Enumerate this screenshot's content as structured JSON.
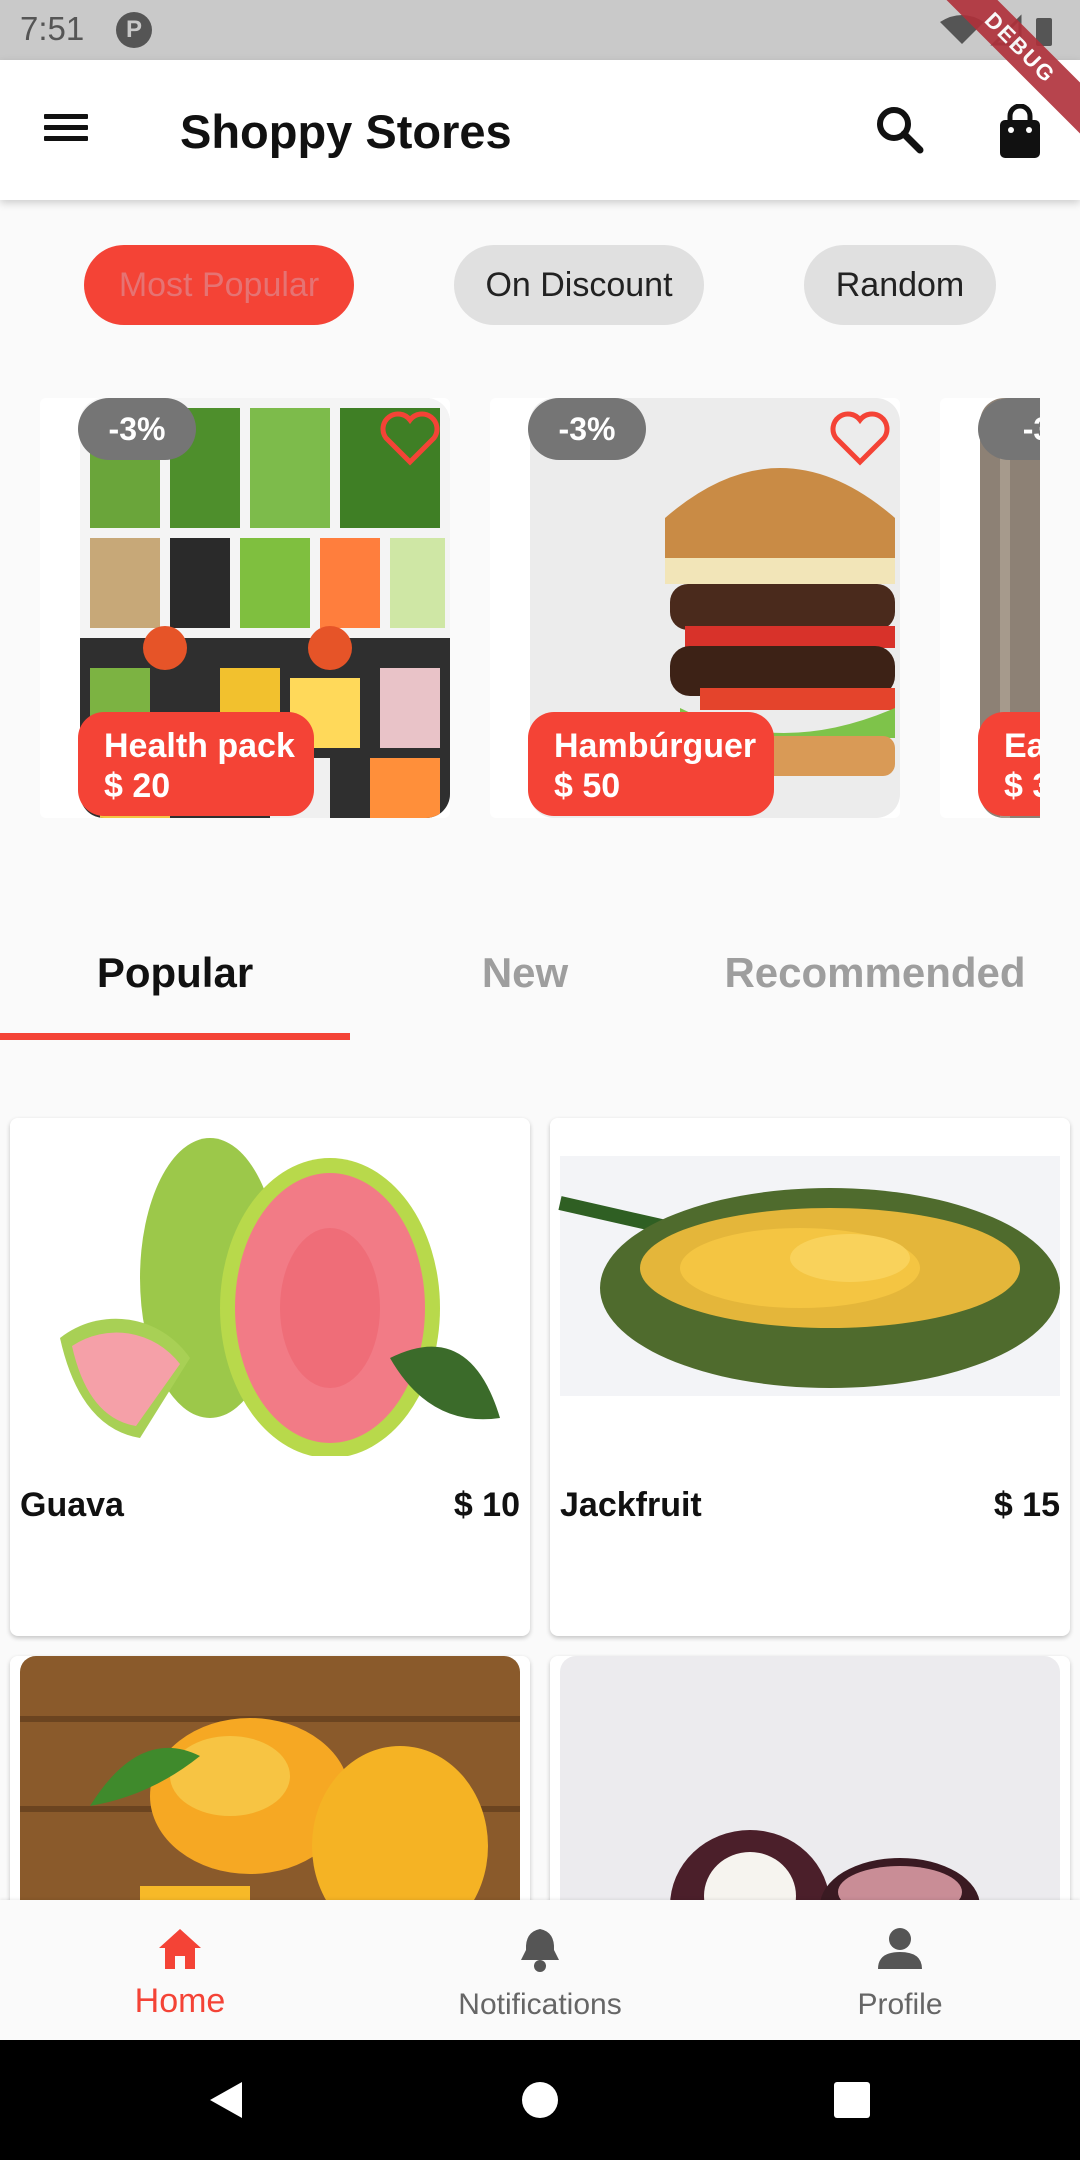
{
  "status_bar": {
    "time": "7:51"
  },
  "debug_banner": "DEBUG",
  "app_bar": {
    "title": "Shoppy Stores"
  },
  "filter_chips": [
    {
      "label": "Most Popular",
      "selected": true
    },
    {
      "label": "On Discount",
      "selected": false
    },
    {
      "label": "Random",
      "selected": false
    }
  ],
  "promo_cards": [
    {
      "name": "Health pack",
      "price": "$ 20",
      "discount": "-3%"
    },
    {
      "name": "Hambúrguer",
      "price": "$ 50",
      "discount": "-3%"
    },
    {
      "name": "Ea",
      "price": "$ 3",
      "discount": "-3"
    }
  ],
  "tabs": [
    {
      "label": "Popular",
      "selected": true
    },
    {
      "label": "New",
      "selected": false
    },
    {
      "label": "Recommended",
      "selected": false
    }
  ],
  "products": [
    {
      "name": "Guava",
      "price": "$ 10"
    },
    {
      "name": "Jackfruit",
      "price": "$ 15"
    },
    {
      "name": "",
      "price": ""
    },
    {
      "name": "",
      "price": ""
    }
  ],
  "bottom_nav": [
    {
      "label": "Home",
      "icon": "home-icon",
      "active": true
    },
    {
      "label": "Notifications",
      "icon": "bell-icon",
      "active": false
    },
    {
      "label": "Profile",
      "icon": "person-icon",
      "active": false
    }
  ],
  "colors": {
    "accent": "#f44336",
    "chip_inactive": "#e0e0e0",
    "badge": "#757575"
  }
}
